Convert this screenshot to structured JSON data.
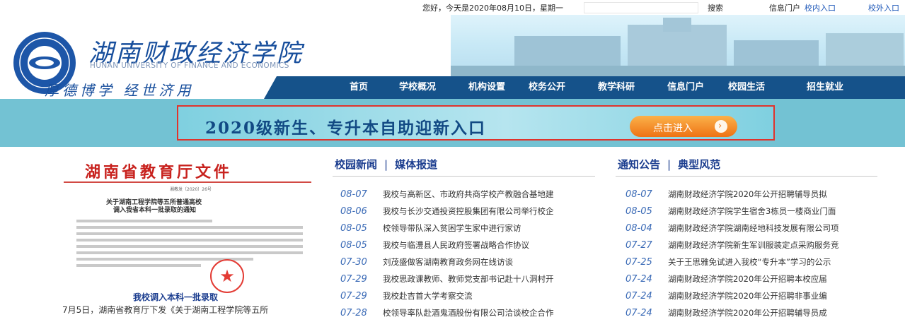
{
  "topbar": {
    "greeting": "您好，今天是2020年08月10日，星期一",
    "search_label": "搜索",
    "portal_label": "信息门户",
    "portal_in": "校内入口",
    "portal_out": "校外入口"
  },
  "header": {
    "school_name": "湖南财政经济学院",
    "school_name_en": "HUNAN UNIVERSITY OF FINANCE AND ECONOMICS",
    "motto": "厚德博学 经世济用"
  },
  "nav": {
    "items": [
      "首页",
      "学校概况",
      "机构设置",
      "校务公开",
      "教学科研",
      "信息门户",
      "校园生活",
      "招生就业"
    ]
  },
  "banner": {
    "text": "2020级新生、专升本自助迎新入口",
    "button_label": "点击进入"
  },
  "doc": {
    "title": "湖南省教育厅文件",
    "number": "湘教发〔2020〕26号",
    "subtitle_1": "关于湖南工程学院等五所普通高校",
    "subtitle_2": "调入我省本科一批录取的通知",
    "caption_title": "我校调入本科一批录取",
    "caption_text": "7月5日，湖南省教育厅下发《关于湖南工程学院等五所"
  },
  "news": {
    "tab_1": "校园新闻",
    "tab_2": "媒体报道",
    "items": [
      {
        "date": "08-07",
        "title": "我校与高新区、市政府共商学校产教融合基地建"
      },
      {
        "date": "08-06",
        "title": "我校与长沙交通投资控股集团有限公司举行校企"
      },
      {
        "date": "08-05",
        "title": "校领导带队深入贫困学生家中进行家访"
      },
      {
        "date": "08-05",
        "title": "我校与临澧县人民政府签署战略合作协议"
      },
      {
        "date": "07-30",
        "title": "刘茂盛做客湖南教育政务网在线访谈"
      },
      {
        "date": "07-29",
        "title": "我校思政课教师、教师党支部书记赴十八洞村开"
      },
      {
        "date": "07-29",
        "title": "我校赴吉首大学考察交流"
      },
      {
        "date": "07-28",
        "title": "校领导率队赴酒鬼酒股份有限公司洽谈校企合作"
      }
    ]
  },
  "notice": {
    "tab_1": "通知公告",
    "tab_2": "典型风范",
    "items": [
      {
        "date": "08-07",
        "title": "湖南财政经济学院2020年公开招聘辅导员拟"
      },
      {
        "date": "08-05",
        "title": "湖南财政经济学院学生宿舍3栋员一楼商业门面"
      },
      {
        "date": "08-04",
        "title": "湖南财政经济学院湖南经地科技发展有限公司项"
      },
      {
        "date": "07-27",
        "title": "湖南财政经济学院新生军训服装定点采购服务竞"
      },
      {
        "date": "07-25",
        "title": "关于王思雅免试进入我校“专升本”学习的公示"
      },
      {
        "date": "07-24",
        "title": "湖南财政经济学院2020年公开招聘本校应届"
      },
      {
        "date": "07-24",
        "title": "湖南财政经济学院2020年公开招聘非事业编"
      },
      {
        "date": "07-24",
        "title": "湖南财政经济学院2020年公开招聘辅导员成"
      }
    ]
  }
}
